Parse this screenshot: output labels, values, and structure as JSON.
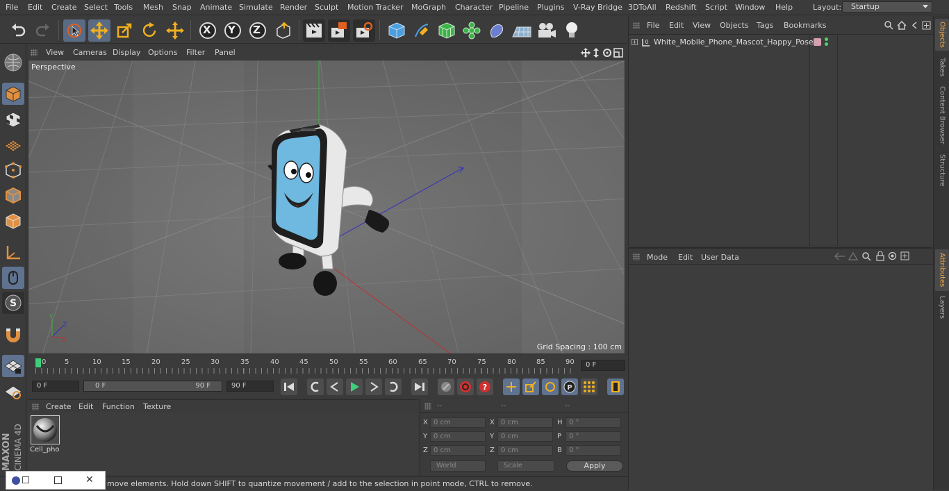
{
  "menubar": {
    "items": [
      "File",
      "Edit",
      "Create",
      "Select",
      "Tools",
      "Mesh",
      "Snap",
      "Animate",
      "Simulate",
      "Render",
      "Sculpt",
      "Motion Tracker",
      "MoGraph",
      "Character",
      "Pipeline",
      "Plugins",
      "V-Ray Bridge",
      "3DToAll",
      "Redshift",
      "Script",
      "Window",
      "Help"
    ],
    "layout_label": "Layout:",
    "layout_value": "Startup"
  },
  "toolbar": {
    "icons": [
      "undo-icon",
      "redo-icon",
      "live-selection-icon",
      "move-icon",
      "scale-icon",
      "rotate-icon",
      "last-tool-icon",
      "x-axis-icon",
      "y-axis-icon",
      "z-axis-icon",
      "coordinate-system-icon",
      "render-view-icon",
      "render-picture-viewer-icon",
      "render-settings-icon",
      "cube-icon",
      "pen-icon",
      "subdivision-icon",
      "mograph-cloner-icon",
      "deformer-icon",
      "floor-icon",
      "camera-icon",
      "light-icon"
    ],
    "axis_x": "X",
    "axis_y": "Y",
    "axis_z": "Z"
  },
  "viewport": {
    "menus": [
      "View",
      "Cameras",
      "Display",
      "Options",
      "Filter",
      "Panel"
    ],
    "label": "Perspective",
    "grid_spacing": "Grid Spacing : 100 cm",
    "axis_x": "X",
    "axis_y": "Y",
    "axis_z": "Z"
  },
  "timeline": {
    "ticks": [
      "0",
      "5",
      "10",
      "15",
      "20",
      "25",
      "30",
      "35",
      "40",
      "45",
      "50",
      "55",
      "60",
      "65",
      "70",
      "75",
      "80",
      "85",
      "90"
    ],
    "current_frame": "0 F"
  },
  "transport": {
    "start_field": "0 F",
    "range_start": "0 F",
    "range_end": "90 F",
    "end_field": "90 F"
  },
  "material_manager": {
    "menus": [
      "Create",
      "Edit",
      "Function",
      "Texture"
    ],
    "material_name": "Cell_pho"
  },
  "coordinates": {
    "headers": [
      "--",
      "--",
      "--"
    ],
    "pos_x": "0 cm",
    "pos_y": "0 cm",
    "pos_z": "0 cm",
    "size_x": "0 cm",
    "size_y": "0 cm",
    "size_z": "0 cm",
    "rot_h": "0 °",
    "rot_p": "0 °",
    "rot_b": "0 °",
    "label_x": "X",
    "label_y": "Y",
    "label_z": "Z",
    "label_h": "H",
    "label_p": "P",
    "label_b": "B",
    "space": "World",
    "mode": "Scale",
    "apply": "Apply"
  },
  "status": {
    "text": "move elements. Hold down SHIFT to quantize movement / add to the selection in point mode, CTRL to remove."
  },
  "object_manager": {
    "menus": [
      "File",
      "Edit",
      "View",
      "Objects",
      "Tags",
      "Bookmarks"
    ],
    "object_name": "White_Mobile_Phone_Mascot_Happy_Pose"
  },
  "attribute_manager": {
    "menus": [
      "Mode",
      "Edit",
      "User Data"
    ]
  },
  "right_tabs": {
    "objects": "Objects",
    "takes": "Takes",
    "content_browser": "Content Browser",
    "structure": "Structure",
    "attributes": "Attributes",
    "layers": "Layers"
  },
  "brand": {
    "maxon": "MAXON",
    "cinema": "CINEMA 4D"
  },
  "colors": {
    "accent": "#e7a44a",
    "selected_tool": "#5f7290",
    "viewport_bg": "#6a6a6a"
  }
}
